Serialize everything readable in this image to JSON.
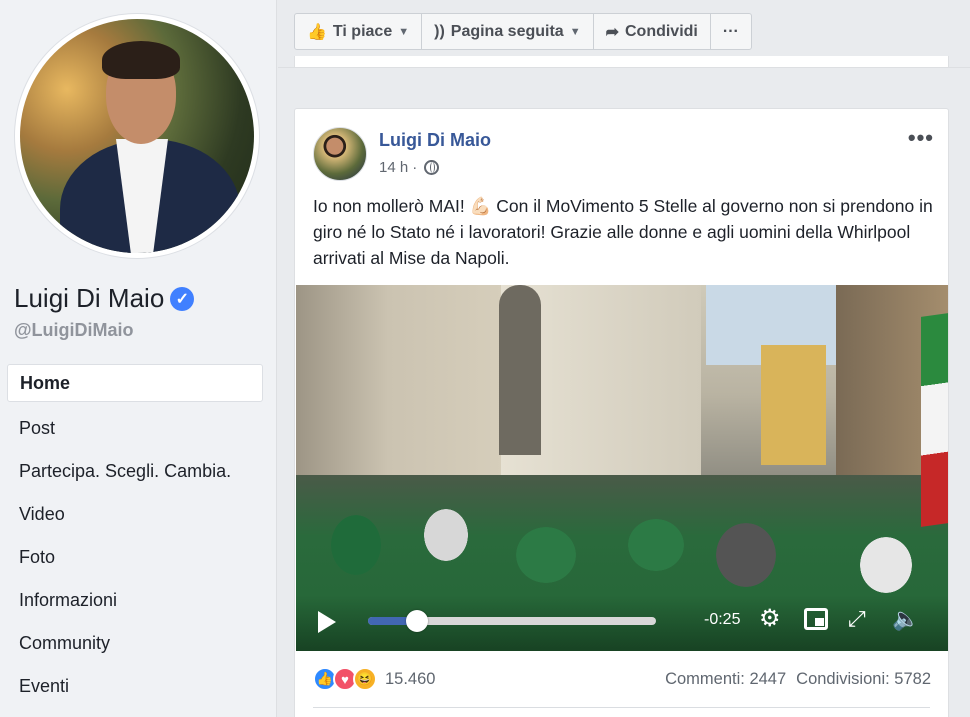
{
  "profile": {
    "name": "Luigi Di Maio",
    "verified_icon": "✓",
    "handle": "@LuigiDiMaio"
  },
  "nav": {
    "items": [
      {
        "label": "Home",
        "active": true
      },
      {
        "label": "Post"
      },
      {
        "label": "Partecipa. Scegli. Cambia."
      },
      {
        "label": "Video"
      },
      {
        "label": "Foto"
      },
      {
        "label": "Informazioni"
      },
      {
        "label": "Community"
      },
      {
        "label": "Eventi"
      }
    ]
  },
  "actions": {
    "like": "Ti piace",
    "follow": "Pagina seguita",
    "share": "Condividi",
    "more": "···"
  },
  "post": {
    "author": "Luigi Di Maio",
    "time": "14 h",
    "separator": "·",
    "more": "•••",
    "text_before": "Io non mollerò MAI! ",
    "emoji": "💪🏻",
    "text_after": " Con il MoVimento 5 Stelle al governo non si prendono in giro né lo Stato né i lavoratori! Grazie alle donne e agli uomini della Whirlpool arrivati al Mise da Napoli.",
    "video": {
      "time_remaining": "-0:25",
      "progress_fraction": 0.17
    },
    "reactions_count": "15.460",
    "comments": "Commenti: 2447",
    "shares": "Condivisioni: 5782"
  },
  "colors": {
    "link": "#385898",
    "accent": "#4267b2",
    "like": "#2e89ff",
    "love": "#f25268",
    "haha": "#f7b125"
  }
}
